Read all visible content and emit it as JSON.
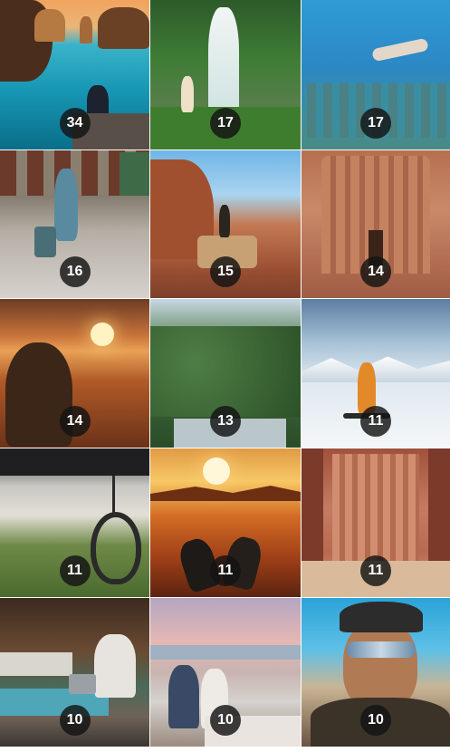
{
  "grid": {
    "tiles": [
      {
        "count": "34",
        "scene": "coastal-rocks-photo"
      },
      {
        "count": "17",
        "scene": "waterfall-photo"
      },
      {
        "count": "17",
        "scene": "underwater-statues-photo"
      },
      {
        "count": "16",
        "scene": "street-traveler-photo"
      },
      {
        "count": "15",
        "scene": "desert-jeep-photo"
      },
      {
        "count": "14",
        "scene": "rock-carved-monastery-photo"
      },
      {
        "count": "14",
        "scene": "desert-sunset-hooded-man-photo"
      },
      {
        "count": "13",
        "scene": "jungle-pool-photo"
      },
      {
        "count": "11",
        "scene": "snowboarder-mountain-photo"
      },
      {
        "count": "11",
        "scene": "hanging-chair-fields-photo"
      },
      {
        "count": "11",
        "scene": "desert-sunset-feet-photo"
      },
      {
        "count": "11",
        "scene": "rock-carved-treasury-photo"
      },
      {
        "count": "10",
        "scene": "pool-laptop-photo"
      },
      {
        "count": "10",
        "scene": "beach-dinner-photo"
      },
      {
        "count": "10",
        "scene": "sunglasses-selfie-photo"
      }
    ]
  }
}
